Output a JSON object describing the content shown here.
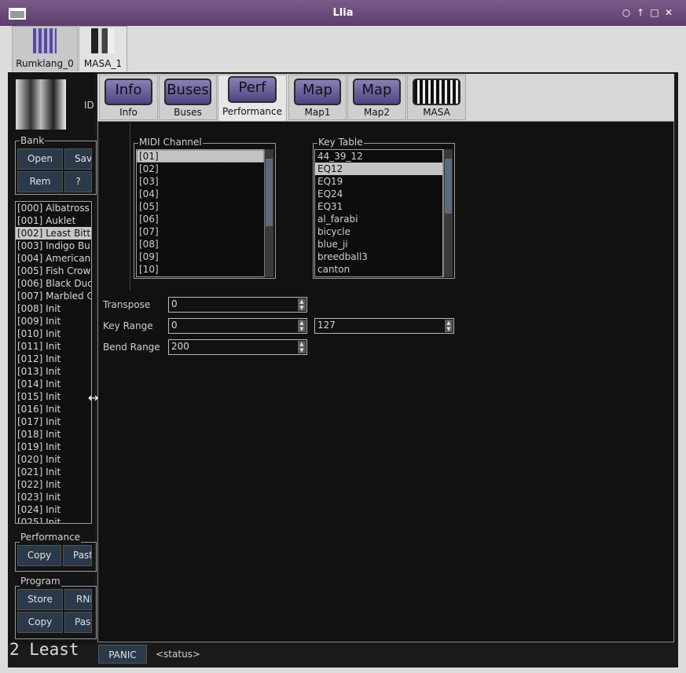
{
  "window": {
    "title": "Llia"
  },
  "synth_tabs": [
    {
      "label": "Rumklang_0"
    },
    {
      "label": "MASA_1"
    }
  ],
  "left": {
    "id_label": "ID",
    "bank": {
      "title": "Bank",
      "open": "Open",
      "save": "Sav",
      "rem": "Rem",
      "help": "?",
      "programs": [
        "[000] Albatross",
        "[001] Auklet",
        "[002] Least Bitt",
        "[003] Indigo Bu",
        "[004] American",
        "[005] Fish Crow",
        "[006] Black Duc",
        "[007] Marbled C",
        "[008] Init",
        "[009] Init",
        "[010] Init",
        "[011] Init",
        "[012] Init",
        "[013] Init",
        "[014] Init",
        "[015] Init",
        "[016] Init",
        "[017] Init",
        "[018] Init",
        "[019] Init",
        "[020] Init",
        "[021] Init",
        "[022] Init",
        "[023] Init",
        "[024] Init",
        "[025] Init"
      ],
      "selected_index": 2
    },
    "performance": {
      "title": "Performance",
      "copy": "Copy",
      "paste": "Past"
    },
    "program": {
      "title": "Program",
      "store": "Store",
      "rnd": "RNI",
      "copy": "Copy",
      "paste": "Past"
    },
    "big_text": "2 Least"
  },
  "page_tabs": [
    {
      "image_text": "Info",
      "label": "Info"
    },
    {
      "image_text": "Buses",
      "label": "Buses"
    },
    {
      "image_text": "Perf",
      "label": "Performance"
    },
    {
      "image_text": "Map",
      "label": "Map1"
    },
    {
      "image_text": "Map",
      "label": "Map2"
    },
    {
      "image_text": "",
      "label": "MASA"
    }
  ],
  "performance": {
    "midi_channel": {
      "title": "MIDI Channel",
      "items": [
        "[01]",
        "[02]",
        "[03]",
        "[04]",
        "[05]",
        "[06]",
        "[07]",
        "[08]",
        "[09]",
        "[10]"
      ]
    },
    "key_table": {
      "title": "Key Table",
      "items": [
        "44_39_12",
        "EQ12",
        "EQ19",
        "EQ24",
        "EQ31",
        "al_farabi",
        "bicycle",
        "blue_ji",
        "breedball3",
        "canton"
      ],
      "selected_index": 1
    },
    "transpose": {
      "label": "Transpose",
      "value": "0"
    },
    "key_range": {
      "label": "Key Range",
      "low": "0",
      "high": "127"
    },
    "bend_range": {
      "label": "Bend Range",
      "value": "200"
    }
  },
  "status_bar": {
    "panic": "PANIC",
    "status": "<status>"
  }
}
